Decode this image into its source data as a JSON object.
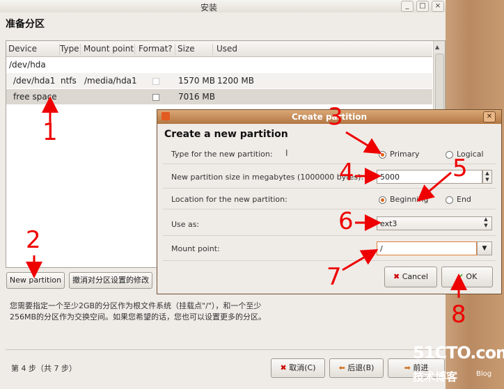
{
  "main": {
    "title": "安装",
    "heading": "准备分区",
    "window_buttons": [
      "_",
      "□",
      "×"
    ],
    "table": {
      "columns": [
        "Device",
        "Type",
        "Mount point",
        "Format?",
        "Size",
        "Used"
      ],
      "rows": [
        {
          "device": "/dev/hda",
          "type": "",
          "mount": "",
          "size": "",
          "used": ""
        },
        {
          "device": "/dev/hda1",
          "type": "ntfs",
          "mount": "/media/hda1",
          "size": "1570 MB",
          "used": "1200 MB"
        },
        {
          "device": "free space",
          "type": "",
          "mount": "",
          "size": "7016 MB",
          "used": ""
        }
      ]
    },
    "new_partition_button": "New partition",
    "undo_button": "撤消对分区设置的修改",
    "info": "您需要指定一个至少2GB的分区作为根文件系统（挂载点\"/\"），和一个至少256MB的分区作为交换空间。如果您希望的话，您也可以设置更多的分区。",
    "step": "第 4 步（共 7 步）",
    "cancel_button": "取消(C)",
    "back_button": "后退(B)",
    "forward_button": "前进"
  },
  "dialog": {
    "title": "Create partition",
    "heading": "Create a new partition",
    "type_label": "Type for the new partition:",
    "primary_label": "Primary",
    "logical_label": "Logical",
    "type_selected": "Primary",
    "size_label": "New partition size in megabytes (1000000 bytes):",
    "size_value": "5000",
    "location_label": "Location for the new partition:",
    "beginning_label": "Beginning",
    "end_label": "End",
    "location_selected": "Beginning",
    "use_as_label": "Use as:",
    "use_as_value": "ext3",
    "mount_label": "Mount point:",
    "mount_value": "/",
    "cancel_button": "Cancel",
    "ok_button": "OK"
  },
  "annotations": [
    "1",
    "2",
    "3",
    "4",
    "5",
    "6",
    "7",
    "8"
  ],
  "watermark": {
    "brand": "51CTO.com",
    "sub": "技术博客",
    "tag": "Blog"
  },
  "colors": {
    "annotation": "#e00000",
    "accent": "#e06418",
    "title_bar": "#b27642"
  }
}
